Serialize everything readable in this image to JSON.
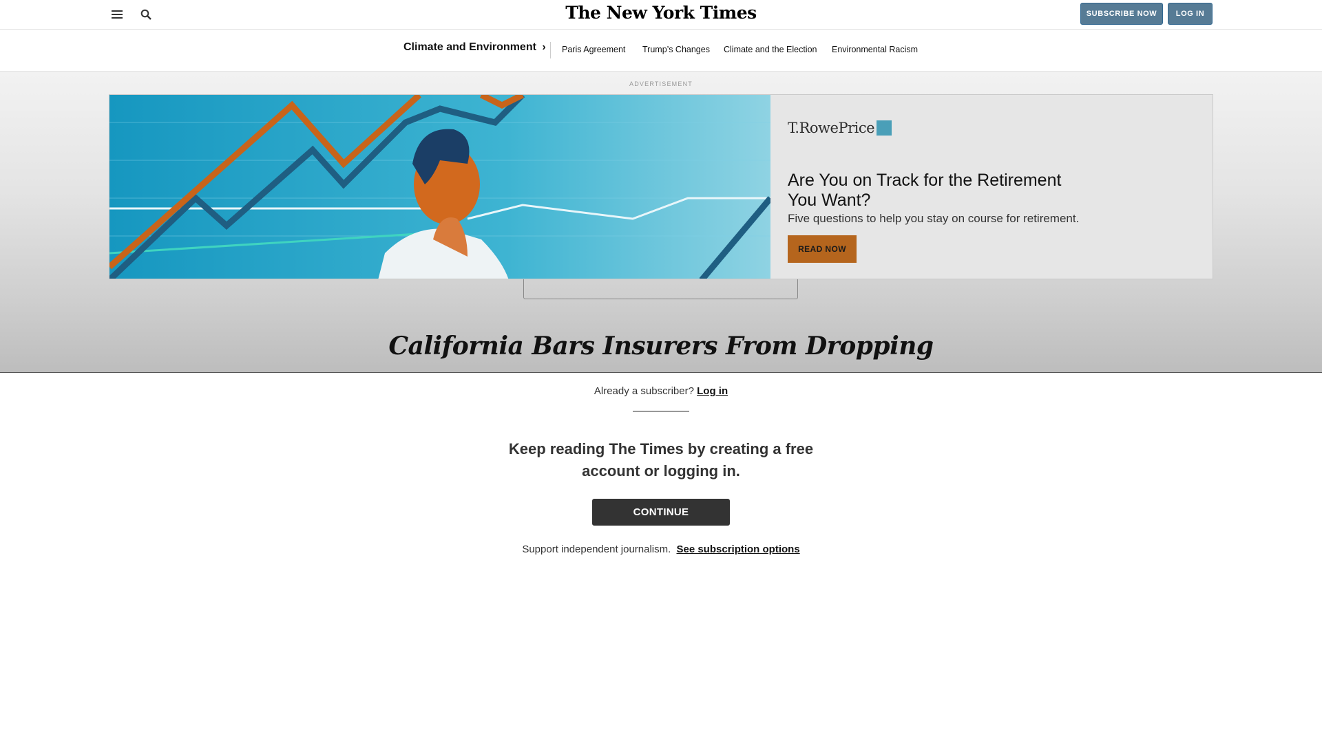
{
  "header": {
    "masthead": "The New York Times",
    "subscribe_label": "SUBSCRIBE NOW",
    "login_label": "LOG IN",
    "icons": [
      "menu-icon",
      "search-icon"
    ]
  },
  "section_nav": {
    "title": "Climate and Environment",
    "chevron": "›",
    "links": [
      "Paris Agreement",
      "Trump’s Changes",
      "Climate and the Election",
      "Environmental Racism"
    ]
  },
  "advertisement": {
    "label": "ADVERTISEMENT",
    "brand": "T.RowePrice",
    "headline": "Are You on Track for the Retirement You Want?",
    "subtext": "Five questions to help you stay on course for retirement.",
    "cta": "READ NOW",
    "colors": {
      "cta": "#b5651d",
      "image_bg": "#1d9cc3",
      "accent_line": "#d2691e"
    }
  },
  "article": {
    "headline": "California Bars Insurers From Dropping"
  },
  "paywall": {
    "already_text": "Already a subscriber?",
    "login_link": "Log in",
    "title": "Keep reading The Times by creating a free account or logging in.",
    "continue_label": "CONTINUE",
    "support_text": "Support independent journalism.",
    "subscription_link": "See subscription options"
  },
  "colors": {
    "header_button": "#567b95",
    "continue_button": "#333333"
  }
}
